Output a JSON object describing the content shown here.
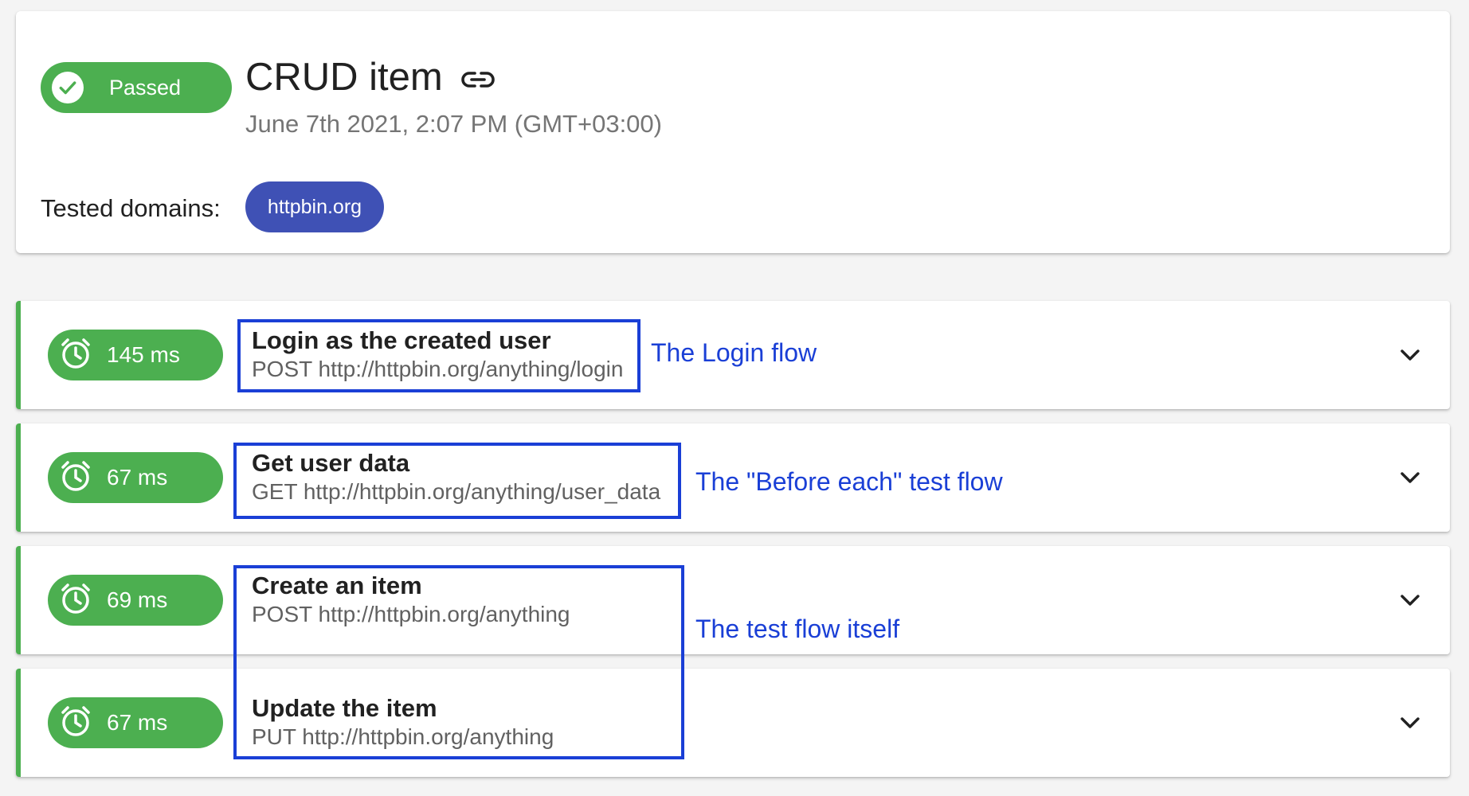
{
  "colors": {
    "passed_green": "#4caf50",
    "domain_chip": "#3f51b5",
    "annotation_blue": "#1a3fd6"
  },
  "summary": {
    "status_label": "Passed",
    "status_icon": "check-circle-icon",
    "title": "CRUD item",
    "title_icon": "link-icon",
    "timestamp": "June 7th 2021, 2:07 PM (GMT+03:00)",
    "domains_label": "Tested domains:",
    "domains": [
      "httpbin.org"
    ]
  },
  "steps": [
    {
      "duration": "145 ms",
      "name": "Login as the created user",
      "request": "POST http://httpbin.org/anything/login"
    },
    {
      "duration": "67 ms",
      "name": "Get user data",
      "request": "GET http://httpbin.org/anything/user_data"
    },
    {
      "duration": "69 ms",
      "name": "Create an item",
      "request": "POST http://httpbin.org/anything"
    },
    {
      "duration": "67 ms",
      "name": "Update the item",
      "request": "PUT http://httpbin.org/anything"
    }
  ],
  "annotations": {
    "login_flow": "The Login flow",
    "before_each_flow": "The \"Before each\" test flow",
    "test_flow": "The test flow itself"
  }
}
